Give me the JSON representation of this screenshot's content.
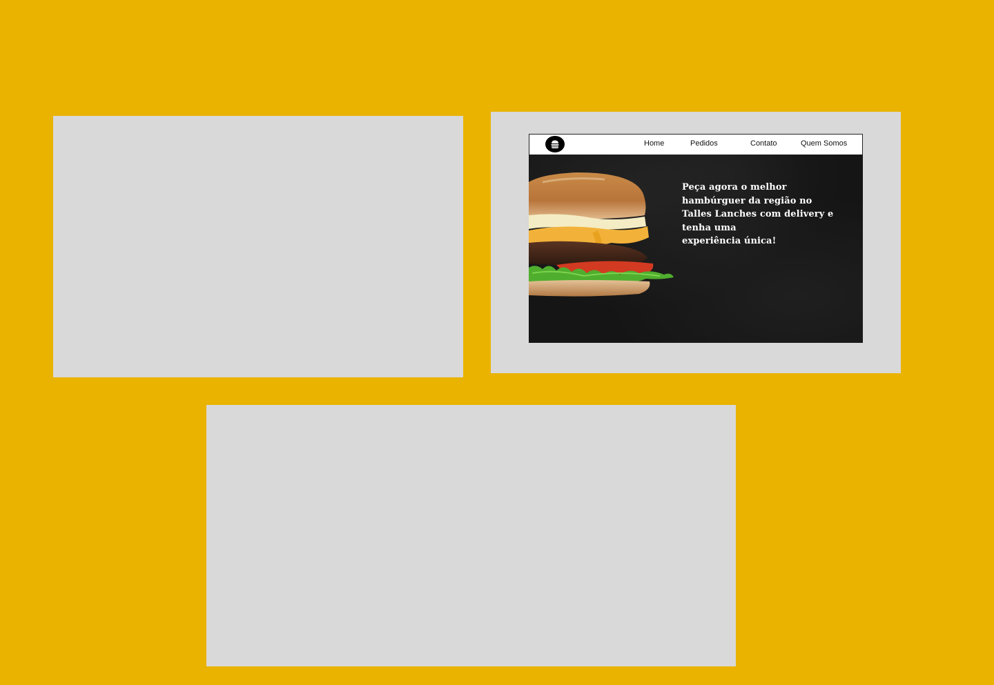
{
  "nav": {
    "home": "Home",
    "pedidos": "Pedidos",
    "contato": "Contato",
    "quem_somos": "Quem Somos"
  },
  "hero": {
    "line1": "Peça agora o melhor",
    "line2": "hambúrguer da região no",
    "line3": "Talles Lanches com delivery e",
    "line4": "tenha uma",
    "line5": "experiência única!"
  },
  "colors": {
    "background": "#eab300",
    "panel": "#d9d9d9",
    "hero": "#151515"
  },
  "icons": {
    "logo": "burger-logo-icon"
  }
}
